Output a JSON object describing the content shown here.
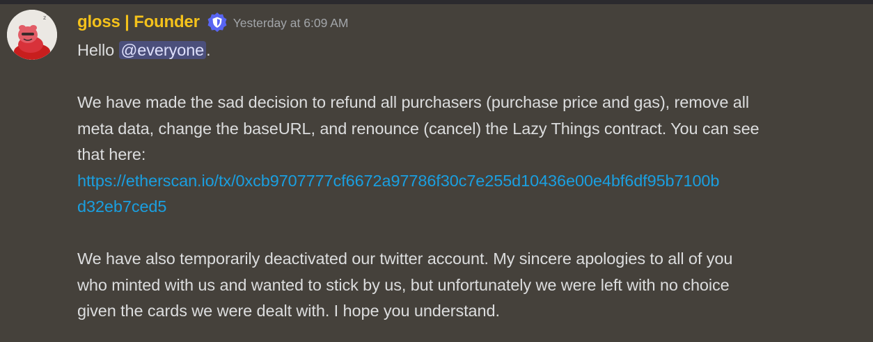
{
  "message": {
    "author": "gloss | Founder",
    "timestamp": "Yesterday at 6:09 AM",
    "greeting_prefix": "Hello",
    "mention": "@everyone",
    "greeting_suffix": ".",
    "paragraph1_lines": [
      "We have made the sad decision to refund all purchasers (purchase price and gas), remove all",
      "meta data, change the baseURL, and renounce (cancel) the Lazy Things contract. You can see",
      "that here:"
    ],
    "link_lines": [
      "https://etherscan.io/tx/0xcb9707777cf6672a97786f30c7e255d10436e00e4bf6df95b7100b",
      "d32eb7ced5"
    ],
    "paragraph2_lines": [
      "We have also temporarily deactivated our twitter account. My sincere apologies to all of you",
      "who minted with us and wanted to stick by us, but unfortunately we were left with no choice",
      "given the cards we were dealt with. I hope you understand."
    ]
  },
  "icons": {
    "avatar": "red-cartoon-creature-avatar",
    "badge": "verified-shield-icon"
  },
  "colors": {
    "background": "#45413b",
    "author": "#f4c21b",
    "link": "#1a9fe0",
    "mention_bg": "#4b4f7b",
    "timestamp": "#a3a6aa"
  }
}
